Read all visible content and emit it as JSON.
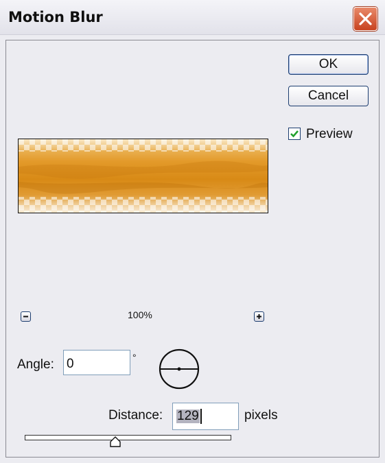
{
  "window": {
    "title": "Motion Blur"
  },
  "buttons": {
    "ok_label": "OK",
    "cancel_label": "Cancel"
  },
  "preview": {
    "label": "Preview",
    "checked": true
  },
  "zoom": {
    "level": "100%",
    "out_icon": "zoom-out-icon",
    "in_icon": "zoom-in-icon"
  },
  "angle": {
    "label": "Angle:",
    "value": "0",
    "unit": "°"
  },
  "distance": {
    "label": "Distance:",
    "value": "129",
    "unit": "pixels"
  },
  "colors": {
    "accent": "#1c3d6f",
    "close": "#c8421f",
    "preview_fill": "#d88a16"
  }
}
